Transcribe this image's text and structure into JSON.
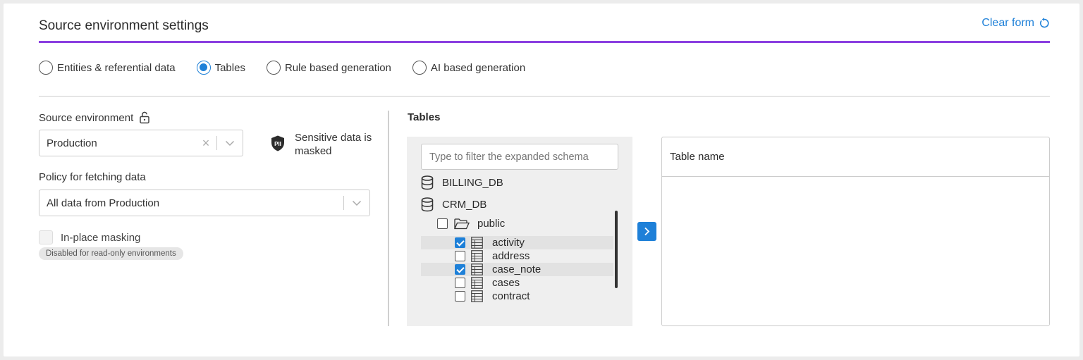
{
  "header": {
    "title": "Source environment settings",
    "clear_label": "Clear form"
  },
  "modes": [
    {
      "label": "Entities & referential data",
      "selected": false
    },
    {
      "label": "Tables",
      "selected": true
    },
    {
      "label": "Rule based generation",
      "selected": false
    },
    {
      "label": "AI based generation",
      "selected": false
    }
  ],
  "source": {
    "env_label": "Source environment",
    "env_value": "Production",
    "sensitive_badge": "PII",
    "sensitive_text": "Sensitive data is masked",
    "policy_label": "Policy for fetching data",
    "policy_value": "All data from Production",
    "inplace_label": "In-place masking",
    "inplace_note": "Disabled for read-only environments"
  },
  "tables": {
    "title": "Tables",
    "filter_placeholder": "Type to filter the expanded schema",
    "databases": [
      "BILLING_DB",
      "CRM_DB"
    ],
    "schema": "public",
    "items": [
      {
        "name": "activity",
        "checked": true
      },
      {
        "name": "address",
        "checked": false
      },
      {
        "name": "case_note",
        "checked": true
      },
      {
        "name": "cases",
        "checked": false
      },
      {
        "name": "contract",
        "checked": false
      }
    ],
    "result_header": "Table name"
  },
  "colors": {
    "accent": "#1e80d8",
    "header_rule": "#8a3ee0"
  }
}
